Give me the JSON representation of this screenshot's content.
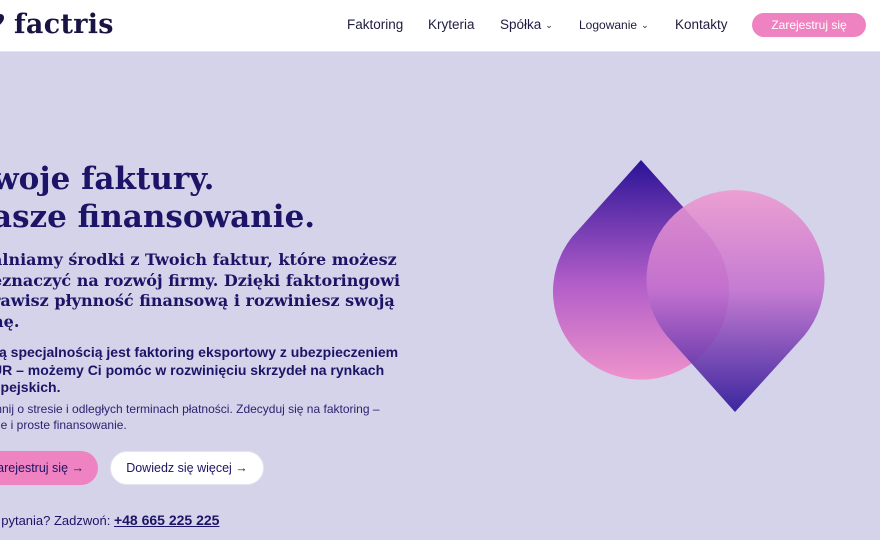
{
  "brand": {
    "name": "factris",
    "logo_icon": "heart-mark-icon"
  },
  "nav": {
    "items": [
      {
        "label": "Faktoring",
        "has_dropdown": false
      },
      {
        "label": "Kryteria",
        "has_dropdown": false
      },
      {
        "label": "Spółka",
        "has_dropdown": true
      },
      {
        "label": "Logowanie",
        "has_dropdown": true
      },
      {
        "label": "Kontakty",
        "has_dropdown": false
      }
    ],
    "cta": "Zarejestruj się",
    "dropdown_icon": "chevron-down-icon"
  },
  "hero": {
    "title_lines": [
      "woje faktury.",
      "asze finansowanie."
    ],
    "lead_lines": [
      "alniamy środki z Twoich faktur, które możesz",
      "eznaczyć na rozwój firmy. Dzięki faktoringowi",
      "rawisz płynność finansową i rozwiniesz swoją",
      "nę."
    ],
    "sub_lines": [
      "zą specjalnością jest faktoring eksportowy z ubezpieczeniem",
      "UR – możemy Ci pomóc w rozwinięciu skrzydeł na rynkach",
      "opejskich."
    ],
    "small_lines": [
      "mnij o stresie i odległych terminach płatności. Zdecyduj się na faktoring –",
      "kie i proste finansowanie."
    ],
    "primary_button": "arejestruj się →",
    "secondary_button": "Dowiedz się więcej →",
    "phone_prefix": ": pytania? Zadzwoń: ",
    "phone": "+48 665 225 225"
  },
  "colors": {
    "background": "#d4d3ea",
    "navy": "#1c1466",
    "pink": "#ef83c2",
    "deep_blue": "#2a1396"
  }
}
